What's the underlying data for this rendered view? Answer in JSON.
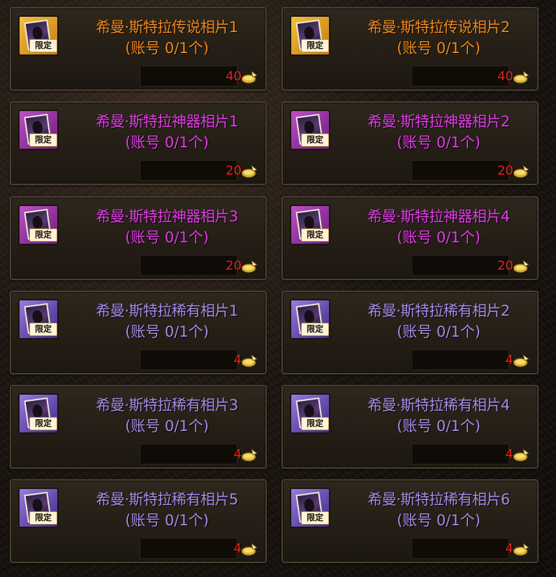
{
  "colors": {
    "legendary": "#f08a1c",
    "artifact": "#e23ee6",
    "rare": "#a98be8",
    "count": "#e8231e"
  },
  "badge_text": "限定",
  "subtitle": "(账号 0/1个)",
  "items": [
    {
      "title": "希曼·斯特拉传说相片1",
      "count": "40",
      "rarity": "legendary",
      "icon": "legendary-photo-icon"
    },
    {
      "title": "希曼·斯特拉传说相片2",
      "count": "40",
      "rarity": "legendary",
      "icon": "legendary-photo-icon"
    },
    {
      "title": "希曼·斯特拉神器相片1",
      "count": "20",
      "rarity": "artifact",
      "icon": "artifact-photo-icon"
    },
    {
      "title": "希曼·斯特拉神器相片2",
      "count": "20",
      "rarity": "artifact",
      "icon": "artifact-photo-icon"
    },
    {
      "title": "希曼·斯特拉神器相片3",
      "count": "20",
      "rarity": "artifact",
      "icon": "artifact-photo-icon"
    },
    {
      "title": "希曼·斯特拉神器相片4",
      "count": "20",
      "rarity": "artifact",
      "icon": "artifact-photo-icon"
    },
    {
      "title": "希曼·斯特拉稀有相片1",
      "count": "4",
      "rarity": "rare",
      "icon": "rare-photo-icon"
    },
    {
      "title": "希曼·斯特拉稀有相片2",
      "count": "4",
      "rarity": "rare",
      "icon": "rare-photo-icon"
    },
    {
      "title": "希曼·斯特拉稀有相片3",
      "count": "4",
      "rarity": "rare",
      "icon": "rare-photo-icon"
    },
    {
      "title": "希曼·斯特拉稀有相片4",
      "count": "4",
      "rarity": "rare",
      "icon": "rare-photo-icon"
    },
    {
      "title": "希曼·斯特拉稀有相片5",
      "count": "4",
      "rarity": "rare",
      "icon": "rare-photo-icon"
    },
    {
      "title": "希曼·斯特拉稀有相片6",
      "count": "4",
      "rarity": "rare",
      "icon": "rare-photo-icon"
    }
  ]
}
